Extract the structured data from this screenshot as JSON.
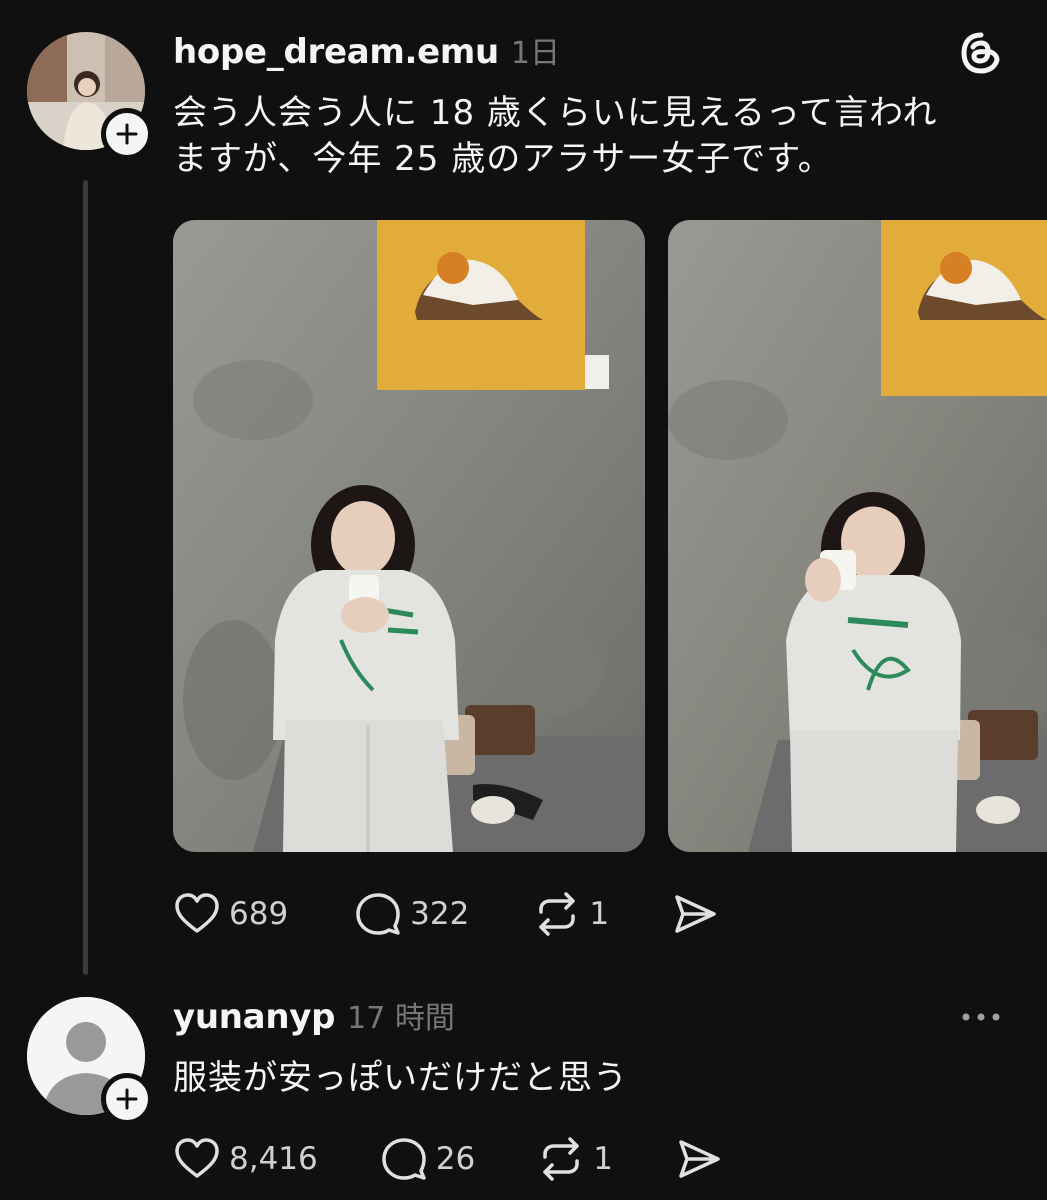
{
  "post": {
    "username": "hope_dream.emu",
    "time": "1日",
    "text_line1": "会う人会う人に 18 歳くらいに見えるって言われ",
    "text_line2": "ますが、今年 25 歳のアラサー女子です。",
    "images": [
      {
        "description_icon": "photo-woman-with-cup"
      },
      {
        "description_icon": "photo-woman-smiling-cup"
      }
    ],
    "likes": "689",
    "replies": "322",
    "reposts": "1"
  },
  "reply": {
    "username": "yunanyp",
    "time": "17 時間",
    "text": "服装が安っぽいだけだと思う",
    "likes": "8,416",
    "replies": "26",
    "reposts": "1"
  },
  "colors": {
    "background": "#101010",
    "text": "#f3f5f7",
    "secondary": "#777777",
    "photo_wall": "#8a8a86",
    "canvas_yellow": "#e2ac3a"
  }
}
